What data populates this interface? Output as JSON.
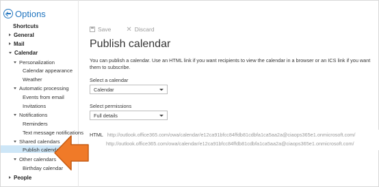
{
  "header": {
    "title": "Options"
  },
  "nav": {
    "shortcuts": "Shortcuts",
    "general": "General",
    "mail": "Mail",
    "calendar": "Calendar",
    "personalization": "Personalization",
    "calendar_appearance": "Calendar appearance",
    "weather": "Weather",
    "automatic_processing": "Automatic processing",
    "events_from_email": "Events from email",
    "invitations": "Invitations",
    "notifications": "Notifications",
    "reminders": "Reminders",
    "text_message_notifications": "Text message notifications",
    "shared_calendars": "Shared calendars",
    "publish_calendar": "Publish calendar",
    "other_calendars": "Other calendars",
    "birthday_calendar": "Birthday calendar",
    "people": "People"
  },
  "toolbar": {
    "save_label": "Save",
    "discard_label": "Discard"
  },
  "main": {
    "title": "Publish calendar",
    "description": "You can publish a calendar. Use an HTML link if you want recipients to view the calendar in a browser or an ICS link if you want them to subscribe.",
    "select_calendar_label": "Select a calendar",
    "select_calendar_value": "Calendar",
    "select_permissions_label": "Select permissions",
    "select_permissions_value": "Full details",
    "html_label": "HTML",
    "html_url": "http://outlook.office365.com/owa/calendar/e12ca91bfcc84ffdb81cdbfa1ca5aa2a@ciaops365e1.onmicrosoft.com/",
    "ics_url": "http://outlook.office365.com/owa/calendar/e12ca91bfcc84ffdb81cdbfa1ca5aa2a@ciaops365e1.onmicrosoft.com/"
  },
  "colors": {
    "accent": "#1e73be",
    "highlight": "#cde6f7",
    "arrow": "#f07a28"
  }
}
